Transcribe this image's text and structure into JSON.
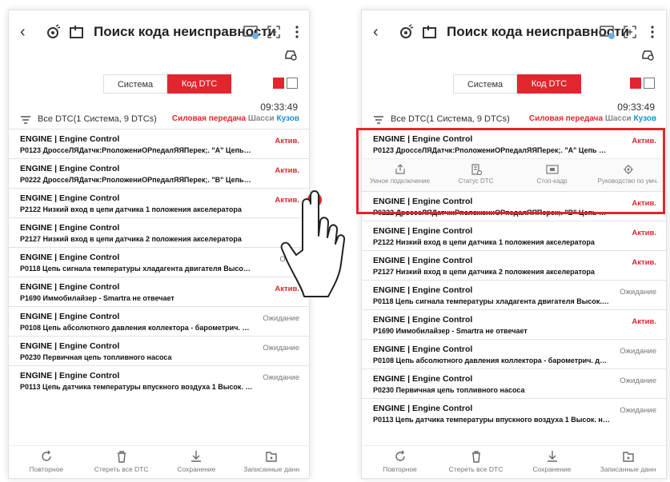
{
  "left": {
    "header": {
      "title": "Поиск кода неисправности"
    },
    "tabs": {
      "system": "Система",
      "dtc": "Код DTC"
    },
    "time": "09:33:49",
    "summary": "Все DTC(1 Система, 9 DTCs)",
    "categories": {
      "power": "Силовая передача",
      "chassis": "Шасси",
      "body": "Кузов"
    },
    "items": [
      {
        "system": "ENGINE | Engine Control",
        "code": "P0123 ДроссеЛЯДатчк:РположениОРпедалЯЯПерек;. \"А\" Цепь Высок...",
        "status": "Актив."
      },
      {
        "system": "ENGINE | Engine Control",
        "code": "P0222 ДроссеЛЯДатчк:РположениОРпедалЯЯПерек;. \"B\" Цепь Низк...",
        "status": "Актив."
      },
      {
        "system": "ENGINE | Engine Control",
        "code": "P2122 Низкий вход в цепи датчика 1 положения акселератора",
        "status": "Актив."
      },
      {
        "system": "ENGINE | Engine Control",
        "code": "P2127 Низкий вход в цепи датчика 2 положения акселератора",
        "status": ""
      },
      {
        "system": "ENGINE | Engine Control",
        "code": "P0118 Цепь сигнала температуры хладагента двигателя Высок. на...",
        "status": "Ожид"
      },
      {
        "system": "ENGINE | Engine Control",
        "code": "P1690 Иммобилайзер - Smartra не отвечает",
        "status": "Актив."
      },
      {
        "system": "ENGINE | Engine Control",
        "code": "P0108 Цепь абсолютного давления коллектора - барометрич. дав...",
        "status": "Ожидание"
      },
      {
        "system": "ENGINE | Engine Control",
        "code": "P0230 Первичная цепь топливного насоса",
        "status": "Ожидание"
      },
      {
        "system": "ENGINE | Engine Control",
        "code": "P0113 Цепь датчика температуры впускного воздуха 1 Высок. на в...",
        "status": "Ожидание"
      }
    ],
    "bottom": {
      "repeat": "Повторное",
      "clear": "Стереть все DTC",
      "save": "Сохранение",
      "recorded": "Записанные данн"
    }
  },
  "right": {
    "header": {
      "title": "Поиск кода неисправности"
    },
    "tabs": {
      "system": "Система",
      "dtc": "Код DTC"
    },
    "time": "09:33:49",
    "summary": "Все DTC(1 Система, 9 DTCs)",
    "categories": {
      "power": "Силовая передача",
      "chassis": "Шасси",
      "body": "Кузов"
    },
    "items": [
      {
        "system": "ENGINE | Engine Control",
        "code": "P0123 ДроссеЛЯДатчк:РположениОРпедалЯЯПерек;. \"А\" Цепь Высок...",
        "status": "Актив."
      },
      {
        "system": "ENGINE | Engine Control",
        "code": "P0222 ДроссеЛЯДатчк:РположениОРпедалЯЯПерек;. \"B\" Цепь Низк...",
        "status": "Актив."
      },
      {
        "system": "ENGINE | Engine Control",
        "code": "P2122 Низкий вход в цепи датчика 1 положения акселератора",
        "status": "Актив."
      },
      {
        "system": "ENGINE | Engine Control",
        "code": "P2127 Низкий вход в цепи датчика 2 положения акселератора",
        "status": "Актив."
      },
      {
        "system": "ENGINE | Engine Control",
        "code": "P0118 Цепь сигнала температуры хладагента двигателя Высок. на...",
        "status": "Ожидание"
      },
      {
        "system": "ENGINE | Engine Control",
        "code": "P1690 Иммобилайзер - Smartra не отвечает",
        "status": "Актив."
      },
      {
        "system": "ENGINE | Engine Control",
        "code": "P0108 Цепь абсолютного давления коллектора - барометрич. дав...",
        "status": "Ожидание"
      },
      {
        "system": "ENGINE | Engine Control",
        "code": "P0230 Первичная цепь топливного насоса",
        "status": "Ожидание"
      },
      {
        "system": "ENGINE | Engine Control",
        "code": "P0113 Цепь датчика температуры впускного воздуха 1 Высок. на в...",
        "status": "Ожидание"
      }
    ],
    "actions": {
      "smart": "Умное подключение",
      "status": "Статус DTC",
      "freeze": "Стоп-кадр",
      "guide": "Руководство по умч."
    },
    "bottom": {
      "repeat": "Повторное",
      "clear": "Стереть все DTC",
      "save": "Сохранение",
      "recorded": "Записанные данн"
    }
  }
}
